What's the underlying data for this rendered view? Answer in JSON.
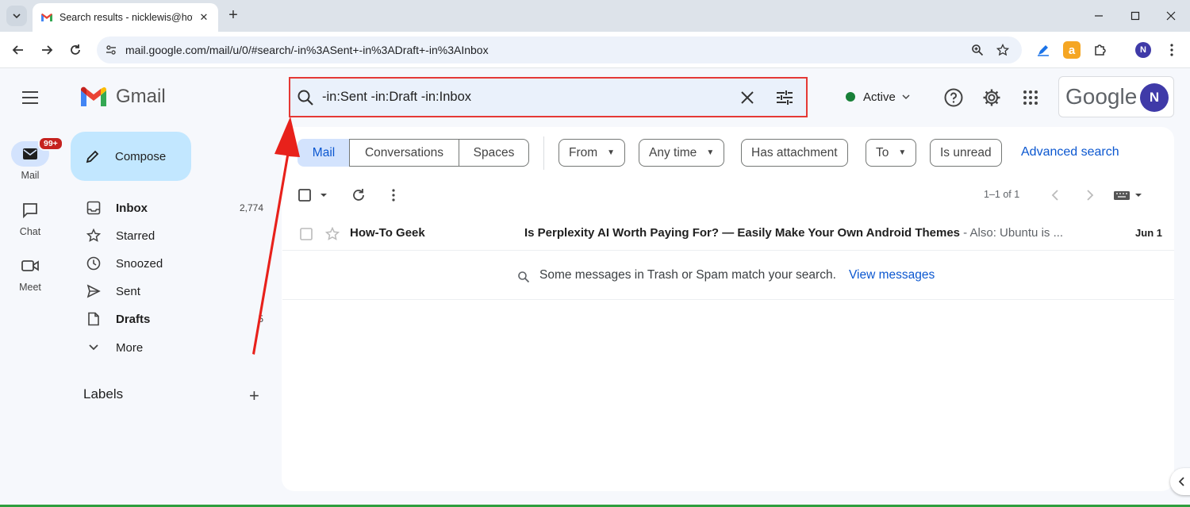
{
  "browser": {
    "tab_title": "Search results - nicklewis@how",
    "url": "mail.google.com/mail/u/0/#search/-in%3ASent+-in%3ADraft+-in%3AInbox",
    "profile_initial": "N"
  },
  "gmail": {
    "logo_text": "Gmail",
    "search_query": "-in:Sent -in:Draft -in:Inbox",
    "status_label": "Active",
    "account_brand": "Google",
    "account_initial": "N"
  },
  "rail": {
    "mail_label": "Mail",
    "mail_badge": "99+",
    "chat_label": "Chat",
    "meet_label": "Meet"
  },
  "compose_label": "Compose",
  "nav": [
    {
      "label": "Inbox",
      "count": "2,774",
      "icon": "inbox-icon",
      "bold": true
    },
    {
      "label": "Starred",
      "count": "",
      "icon": "star-icon",
      "bold": false
    },
    {
      "label": "Snoozed",
      "count": "",
      "icon": "clock-icon",
      "bold": false
    },
    {
      "label": "Sent",
      "count": "",
      "icon": "send-icon",
      "bold": false
    },
    {
      "label": "Drafts",
      "count": "5",
      "icon": "draft-icon",
      "bold": true
    },
    {
      "label": "More",
      "count": "",
      "icon": "chevron-down-icon",
      "bold": false
    }
  ],
  "labels_heading": "Labels",
  "scope_tabs": [
    "Mail",
    "Conversations",
    "Spaces"
  ],
  "filters": {
    "from": "From",
    "any_time": "Any time",
    "has_attachment": "Has attachment",
    "to": "To",
    "is_unread": "Is unread",
    "advanced_search": "Advanced search"
  },
  "pagination": "1–1 of 1",
  "messages": [
    {
      "sender": "How-To Geek",
      "subject": "Is Perplexity AI Worth Paying For? — Easily Make Your Own Android Themes",
      "snippet": " - Also: Ubuntu is ...",
      "date": "Jun 1"
    }
  ],
  "trash_notice": {
    "text": "Some messages in Trash or Spam match your search.",
    "link": "View messages"
  },
  "colors": {
    "accent_blue": "#0b57d0",
    "compose_bg": "#c2e7ff",
    "highlight_red": "#e53935",
    "status_green": "#188038"
  }
}
